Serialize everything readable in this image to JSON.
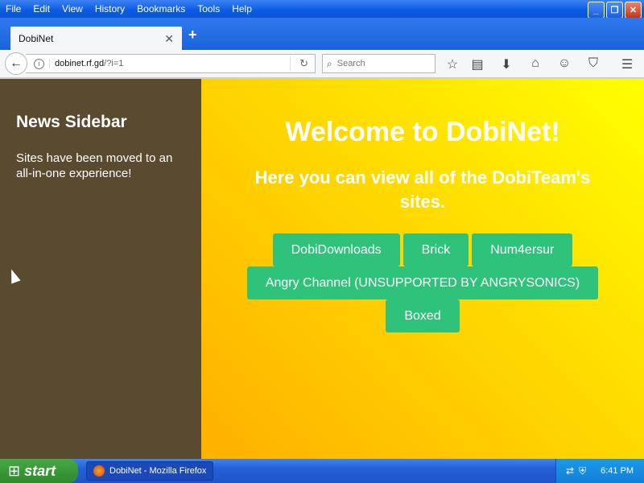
{
  "menubar": {
    "items": [
      "File",
      "Edit",
      "View",
      "History",
      "Bookmarks",
      "Tools",
      "Help"
    ]
  },
  "tab": {
    "title": "DobiNet"
  },
  "navbar": {
    "url_domain": "dobinet.rf.gd",
    "url_path": "/?i=1",
    "search_placeholder": "Search"
  },
  "sidebar": {
    "title": "News Sidebar",
    "text": "Sites have been moved to an all-in-one experience!"
  },
  "main": {
    "title": "Welcome to DobiNet!",
    "subtitle": "Here you can view all of the DobiTeam's sites.",
    "buttons": [
      "DobiDownloads",
      "Brick",
      "Num4ersur",
      "Angry Channel (UNSUPPORTED BY ANGRYSONICS)",
      "Boxed"
    ]
  },
  "taskbar": {
    "start_label": "start",
    "task_label": "DobiNet - Mozilla Firefox",
    "clock": "6:41 PM"
  },
  "colors": {
    "sidebar_bg": "#5a4a2f",
    "button_bg": "#2ec27a",
    "main_gradient_top": "#ffff00",
    "main_gradient_bottom": "#ffb000"
  }
}
